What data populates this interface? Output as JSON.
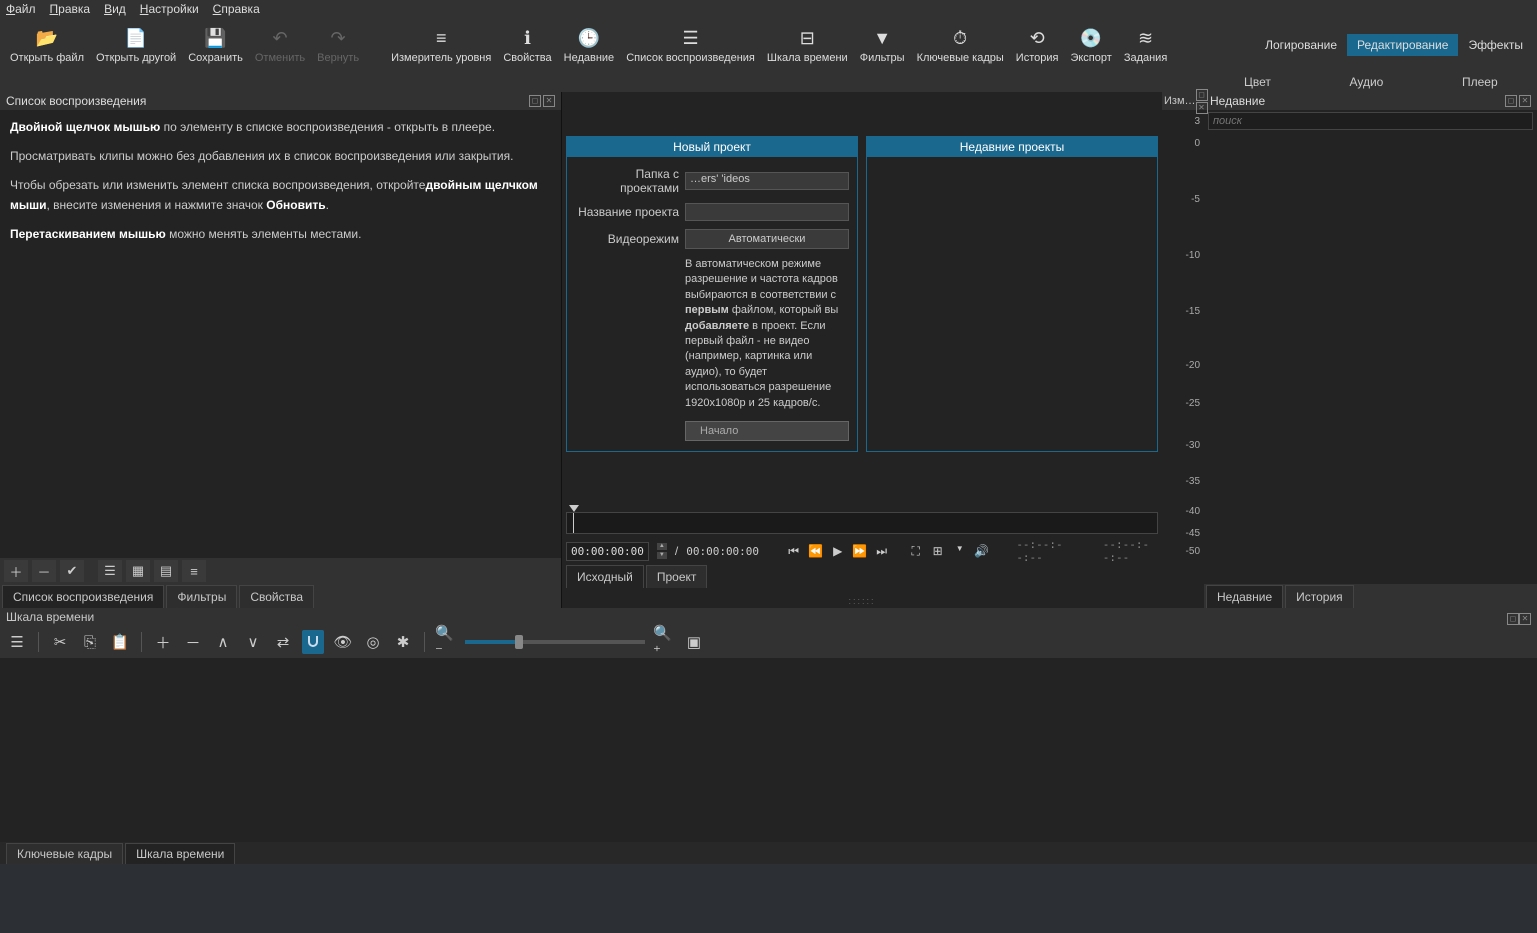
{
  "menu": {
    "items": [
      "Файл",
      "Правка",
      "Вид",
      "Настройки",
      "Справка"
    ]
  },
  "toolbar": {
    "open_file": "Открыть файл",
    "open_other": "Открыть другой",
    "save": "Сохранить",
    "undo": "Отменить",
    "redo": "Вернуть",
    "level_meter": "Измеритель уровня",
    "properties": "Свойства",
    "recent": "Недавние",
    "playlist": "Список воспроизведения",
    "timeline": "Шкала времени",
    "filters": "Фильтры",
    "keyframes": "Ключевые кадры",
    "history": "История",
    "export": "Экспорт",
    "tasks": "Задания",
    "modes": {
      "logging": "Логирование",
      "editing": "Редактирование",
      "effects": "Эффекты"
    }
  },
  "context": {
    "color": "Цвет",
    "audio": "Аудио",
    "player": "Плеер"
  },
  "playlist": {
    "title": "Список воспроизведения",
    "help": {
      "p1_strong": "Двойной щелчок мышью",
      "p1_rest": " по элементу в списке воспроизведения - открыть в плеере.",
      "p2": "Просматривать клипы можно без добавления их в список воспроизведения или закрытия.",
      "p3_pre": "Чтобы обрезать или изменить элемент списка воспроизведения, откройте",
      "p3_strong": "двойным щелчком мыши",
      "p3_mid": ", внесите изменения и нажмите значок ",
      "p3_strong2": "Обновить",
      "p3_end": ".",
      "p4_strong": "Перетаскиванием мышью",
      "p4_rest": " можно менять элементы местами."
    },
    "tabs": {
      "playlist": "Список воспроизведения",
      "filters": "Фильтры",
      "properties": "Свойства"
    }
  },
  "project": {
    "new_title": "Новый проект",
    "recent_title": "Недавние проекты",
    "folder_label": "Папка с проектами",
    "folder_value": "…ers'                        'ideos",
    "name_label": "Название проекта",
    "name_value": "",
    "mode_label": "Видеорежим",
    "mode_value": "Автоматически",
    "note_pre": "В автоматическом режиме разрешение и частота кадров выбираются в соответствии с ",
    "note_b1": "первым",
    "note_mid": " файлом, который вы ",
    "note_b2": "добавляете",
    "note_post": " в проект. Если первый файл - не видео (например, картинка или аудио), то будет использоваться разрешение 1920x1080p и 25 кадров/с.",
    "start": "Начало"
  },
  "transport": {
    "tc": "00:00:00:00",
    "sep": "/",
    "total": "00:00:00:00",
    "in": "--:--:--:--",
    "out": "--:--:--:--",
    "src_tab": "Исходный",
    "proj_tab": "Проект"
  },
  "meter": {
    "title": "Изм…",
    "ticks": [
      "3",
      "0",
      "-5",
      "-10",
      "-15",
      "-20",
      "-25",
      "-30",
      "-35",
      "-40",
      "-45",
      "-50"
    ]
  },
  "recent": {
    "title": "Недавние",
    "search": "поиск",
    "tabs": {
      "recent": "Недавние",
      "history": "История"
    }
  },
  "timeline": {
    "title": "Шкала времени",
    "tabs": {
      "keyframes": "Ключевые кадры",
      "timeline": "Шкала времени"
    }
  }
}
